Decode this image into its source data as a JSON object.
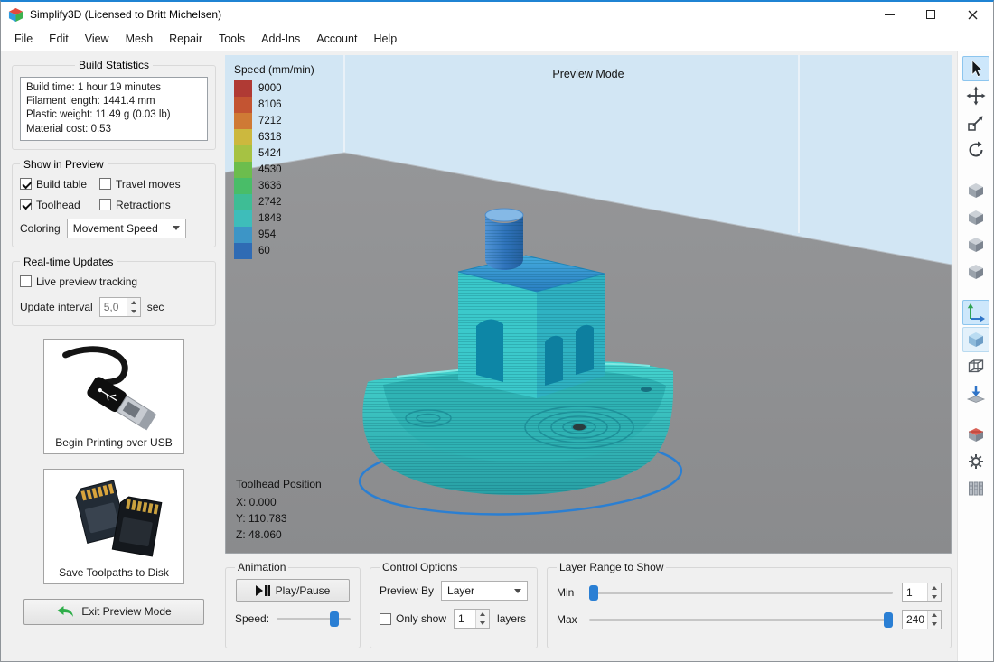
{
  "window": {
    "title": "Simplify3D (Licensed to Britt Michelsen)"
  },
  "menubar": {
    "items": [
      "File",
      "Edit",
      "View",
      "Mesh",
      "Repair",
      "Tools",
      "Add-Ins",
      "Account",
      "Help"
    ]
  },
  "left_panel": {
    "build_statistics": {
      "title": "Build Statistics",
      "lines": [
        "Build time: 1 hour 19 minutes",
        "Filament length: 1441.4 mm",
        "Plastic weight: 11.49 g (0.03 lb)",
        "Material cost: 0.53"
      ]
    },
    "show_in_preview": {
      "title": "Show in Preview",
      "checkboxes": [
        {
          "label": "Build table",
          "checked": true
        },
        {
          "label": "Travel moves",
          "checked": false
        },
        {
          "label": "Toolhead",
          "checked": true
        },
        {
          "label": "Retractions",
          "checked": false
        }
      ],
      "coloring_label": "Coloring",
      "coloring_value": "Movement Speed"
    },
    "realtime_updates": {
      "title": "Real-time Updates",
      "live_preview_label": "Live preview tracking",
      "live_preview_checked": false,
      "update_interval_label": "Update interval",
      "update_interval_value": "5,0",
      "update_interval_unit": "sec"
    },
    "usb_button_label": "Begin Printing over USB",
    "sd_button_label": "Save Toolpaths to Disk",
    "exit_button_label": "Exit Preview Mode"
  },
  "viewport": {
    "mode_label": "Preview Mode",
    "legend": {
      "title": "Speed (mm/min)",
      "stops": [
        {
          "value": "9000",
          "color": "#b03a34"
        },
        {
          "value": "8106",
          "color": "#c35432"
        },
        {
          "value": "7212",
          "color": "#cf7a35"
        },
        {
          "value": "6318",
          "color": "#ccb83e"
        },
        {
          "value": "5424",
          "color": "#a6c243"
        },
        {
          "value": "4530",
          "color": "#6cbd4d"
        },
        {
          "value": "3636",
          "color": "#49bd68"
        },
        {
          "value": "2742",
          "color": "#3ebd95"
        },
        {
          "value": "1848",
          "color": "#3ebdba"
        },
        {
          "value": "954",
          "color": "#3d95c6"
        },
        {
          "value": "60",
          "color": "#2f6bb4"
        }
      ]
    },
    "toolhead_position": {
      "title": "Toolhead Position",
      "x": "X: 0.000",
      "y": "Y: 110.783",
      "z": "Z: 48.060"
    }
  },
  "bottom_bar": {
    "animation": {
      "title": "Animation",
      "play_pause_label": "Play/Pause",
      "speed_label": "Speed:",
      "speed_percent": 78
    },
    "control_options": {
      "title": "Control Options",
      "preview_by_label": "Preview By",
      "preview_by_value": "Layer",
      "only_show_label": "Only show",
      "only_show_checked": false,
      "only_show_value": "1",
      "layers_label": "layers"
    },
    "layer_range": {
      "title": "Layer Range to Show",
      "min_label": "Min",
      "min_value": "1",
      "min_percent": 0,
      "max_label": "Max",
      "max_value": "240",
      "max_percent": 100
    }
  },
  "right_toolbar": {
    "tools": [
      "select-tool",
      "move-tool",
      "scale-tool",
      "rotate-tool",
      "view-cube-a",
      "view-cube-b",
      "view-cube-c",
      "view-cube-d",
      "coordinate-axes-tool",
      "shaded-view-tool",
      "wireframe-view-tool",
      "place-on-bed-tool",
      "cross-section-tool",
      "machine-gear-tool",
      "support-structures-tool"
    ],
    "selected": [
      "select-tool",
      "coordinate-axes-tool",
      "shaded-view-tool"
    ]
  }
}
